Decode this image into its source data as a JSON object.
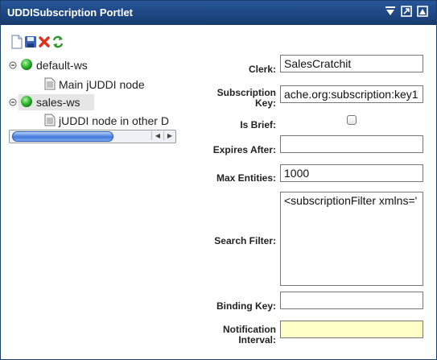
{
  "window": {
    "title": "UDDISubscription Portlet",
    "controls": [
      "menu-icon",
      "maximize-icon",
      "restore-icon"
    ]
  },
  "toolbar": {
    "icons": [
      "new-document-icon",
      "save-icon",
      "delete-icon",
      "refresh-icon"
    ]
  },
  "tree": {
    "nodes": [
      {
        "label": "default-ws",
        "icon": "green-ball-icon",
        "expanded": true
      },
      {
        "label": "Main jUDDI node",
        "icon": "document-icon"
      },
      {
        "label": "sales-ws",
        "icon": "green-ball-icon",
        "expanded": true,
        "selected": true
      },
      {
        "label": "jUDDI node in other D",
        "icon": "document-icon"
      }
    ]
  },
  "form": {
    "clerk": {
      "label": "Clerk:",
      "value": "SalesCratchit"
    },
    "subscription_key": {
      "label": "Subscription Key:",
      "label_line1": "Subscription",
      "label_line2": "Key:",
      "value": "ache.org:subscription:key1"
    },
    "is_brief": {
      "label": "Is Brief:",
      "checked": false
    },
    "expires_after": {
      "label": "Expires After:",
      "value": ""
    },
    "max_entities": {
      "label": "Max Entities:",
      "value": "1000"
    },
    "search_filter": {
      "label": "Search Filter:",
      "value": "<subscriptionFilter xmlns='"
    },
    "binding_key": {
      "label": "Binding Key:",
      "value": ""
    },
    "notification_interval": {
      "label": "Notification Interval:",
      "label_line1": "Notification",
      "label_line2": "Interval:",
      "value": ""
    }
  },
  "colors": {
    "titlebar": "#1f4b8a",
    "selected_row": "#e6e6e6",
    "highlight_field": "#ffffc8",
    "ball": "#2fb82f"
  }
}
